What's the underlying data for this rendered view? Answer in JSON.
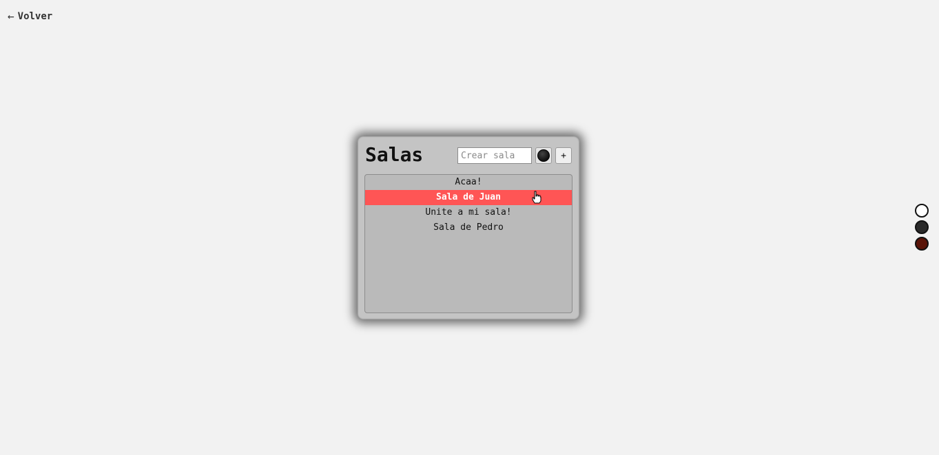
{
  "nav": {
    "back_label": "Volver",
    "back_icon": "arrow-left-icon"
  },
  "panel": {
    "title": "Salas",
    "create_input": {
      "placeholder": "Crear sala",
      "value": ""
    },
    "color_button": {
      "icon": "color-picker-icon",
      "color": "#1a1a1a"
    },
    "add_button_label": "+",
    "rooms": [
      {
        "name": "Acaa!",
        "selected": false
      },
      {
        "name": "Sala de Juan",
        "selected": true
      },
      {
        "name": "Unite a mi sala!",
        "selected": false
      },
      {
        "name": "Sala de Pedro",
        "selected": false
      }
    ]
  },
  "theme_options": [
    {
      "name": "light",
      "color": "#ffffff"
    },
    {
      "name": "dark",
      "color": "#2a2a2a"
    },
    {
      "name": "red",
      "color": "#5a1408"
    }
  ],
  "colors": {
    "background": "#f2f2f2",
    "panel": "#c4c4c4",
    "list": "#bababa",
    "accent_selected": "#ff5555"
  }
}
